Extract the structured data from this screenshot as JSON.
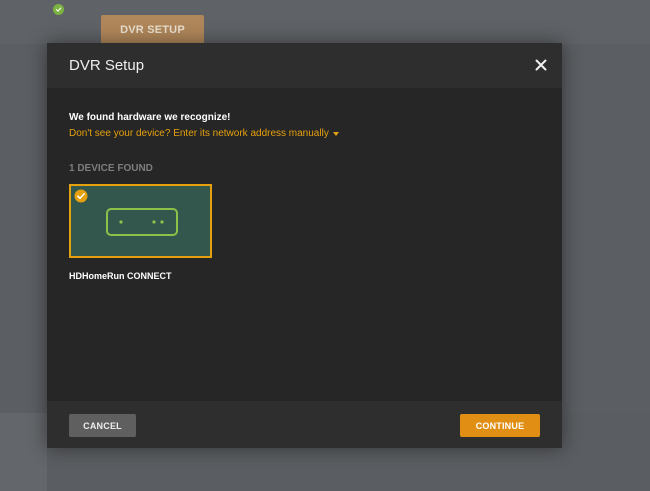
{
  "background": {
    "dvr_button_label": "DVR SETUP",
    "status_icon": "check-circle-icon"
  },
  "modal": {
    "title": "DVR Setup",
    "close_icon": "close-icon",
    "found_text": "We found hardware we recognize!",
    "manual_link": "Don't see your device? Enter its network address manually",
    "devices_found_label": "1 DEVICE FOUND",
    "devices": [
      {
        "name": "HDHomeRun CONNECT",
        "selected": true,
        "icon": "tuner-device-icon"
      }
    ],
    "cancel_label": "CANCEL",
    "continue_label": "CONTINUE"
  },
  "colors": {
    "accent": "#e5a00d",
    "continue_button": "#e08f14",
    "device_card_bg": "#33574d",
    "device_graphic": "#8bc34a",
    "modal_bg": "#262626",
    "modal_header_bg": "#2e2e2e"
  }
}
